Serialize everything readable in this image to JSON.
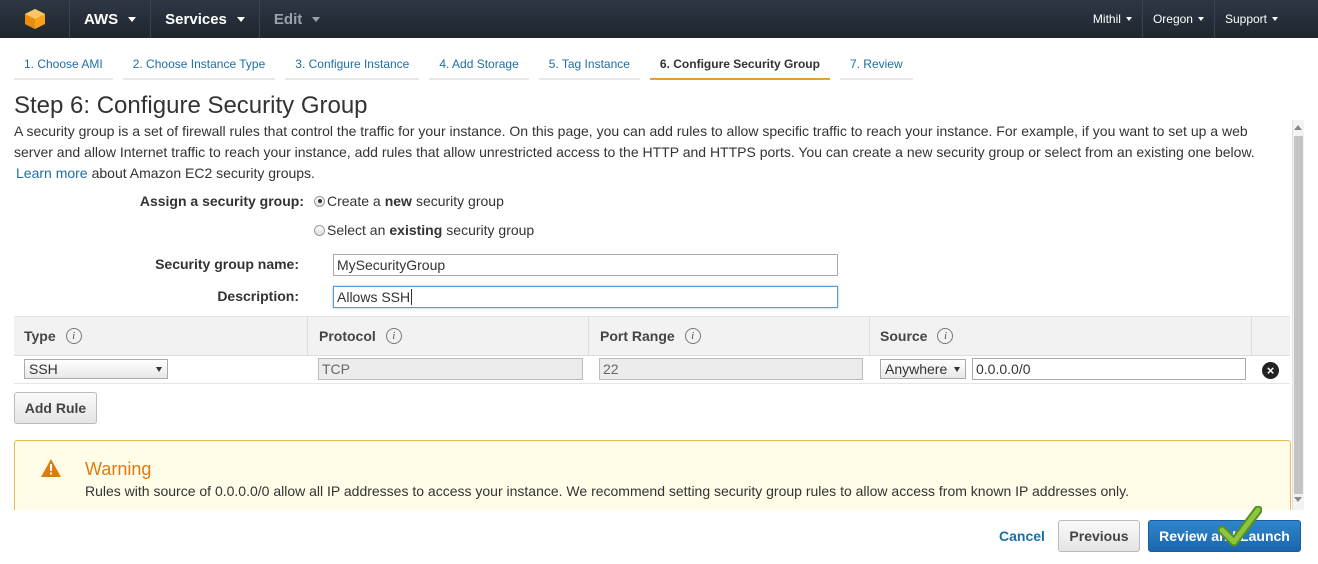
{
  "nav": {
    "brand": "AWS",
    "services": "Services",
    "edit": "Edit",
    "user": "Mithil",
    "region": "Oregon",
    "support": "Support"
  },
  "steps": [
    {
      "label": "1. Choose AMI"
    },
    {
      "label": "2. Choose Instance Type"
    },
    {
      "label": "3. Configure Instance"
    },
    {
      "label": "4. Add Storage"
    },
    {
      "label": "5. Tag Instance"
    },
    {
      "label": "6. Configure Security Group",
      "active": true
    },
    {
      "label": "7. Review"
    }
  ],
  "page": {
    "title": "Step 6: Configure Security Group",
    "description": "A security group is a set of firewall rules that control the traffic for your instance. On this page, you can add rules to allow specific traffic to reach your instance. For example, if you want to set up a web server and allow Internet traffic to reach your instance, add rules that allow unrestricted access to the HTTP and HTTPS ports. You can create a new security group or select from an existing one below.",
    "learn_more": "Learn more",
    "learn_more_suffix": "about Amazon EC2 security groups."
  },
  "form": {
    "assign_label": "Assign a security group:",
    "option_new_pre": "Create a",
    "option_new_bold": "new",
    "option_new_post": "security group",
    "option_existing_pre": "Select an",
    "option_existing_bold": "existing",
    "option_existing_post": "security group",
    "name_label": "Security group name:",
    "name_value": "MySecurityGroup",
    "desc_label": "Description:",
    "desc_value": "Allows SSH"
  },
  "table": {
    "headers": [
      "Type",
      "Protocol",
      "Port Range",
      "Source"
    ],
    "row": {
      "type": "SSH",
      "protocol": "TCP",
      "port_range": "22",
      "source_type": "Anywhere",
      "source_cidr": "0.0.0.0/0"
    }
  },
  "buttons": {
    "add_rule": "Add Rule",
    "cancel": "Cancel",
    "previous": "Previous",
    "review_launch": "Review and Launch"
  },
  "warning": {
    "title": "Warning",
    "text": "Rules with source of 0.0.0.0/0 allow all IP addresses to access your instance. We recommend setting security group rules to allow access from known IP addresses only."
  },
  "colors": {
    "nav_bg": "#232f3e",
    "link": "#1d6fa5",
    "active_tab_underline": "#e79f3a",
    "warning_orange": "#e07b12",
    "primary_button": "#1a66ad"
  }
}
